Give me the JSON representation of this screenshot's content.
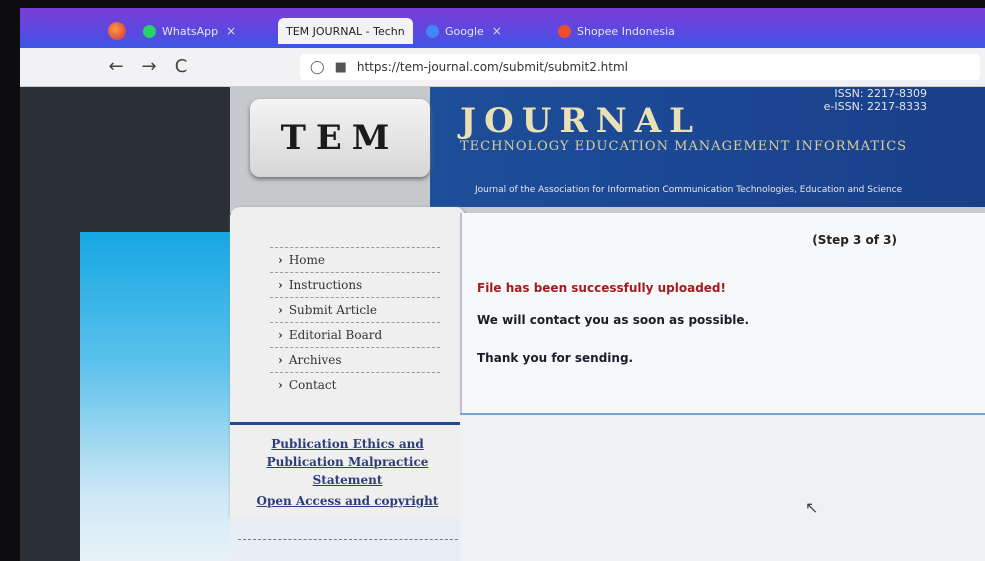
{
  "browser": {
    "tabs": [
      {
        "label": "WhatsApp",
        "icon": "whatsapp-icon",
        "color": "#25d366",
        "active": false
      },
      {
        "label": "TEM JOURNAL - Techn",
        "icon": "",
        "color": "",
        "active": true
      },
      {
        "label": "Google",
        "icon": "google-icon",
        "color": "#4285f4",
        "active": false
      },
      {
        "label": "Shopee Indonesia",
        "icon": "shopee-icon",
        "color": "#ee4d2d",
        "active": false
      }
    ],
    "close_glyph": "×",
    "back_glyph": "←",
    "forward_glyph": "→",
    "reload_glyph": "C",
    "url": "https://tem-journal.com/submit/submit2.html"
  },
  "header": {
    "logo_text": "TEM",
    "journal_title": "JOURNAL",
    "journal_subtitle": "TECHNOLOGY EDUCATION MANAGEMENT INFORMATICS",
    "issn": "ISSN: 2217-8309",
    "eissn": "e-ISSN: 2217-8333",
    "association": "Journal of the Association for Information Communication Technologies, Education and Science"
  },
  "sidebar": {
    "arrow": "›",
    "items": [
      {
        "label": "Home"
      },
      {
        "label": "Instructions"
      },
      {
        "label": "Submit Article"
      },
      {
        "label": "Editorial Board"
      },
      {
        "label": "Archives"
      },
      {
        "label": "Contact"
      }
    ],
    "ethics_line1": "Publication Ethics and",
    "ethics_line2": "Publication Malpractice Statement",
    "open_access": "Open Access and copyright"
  },
  "content": {
    "step": "(Step 3 of 3)",
    "success": "File has been successfully uploaded!",
    "contact": "We will contact you as soon as possible.",
    "thanks": "Thank you for sending."
  },
  "colors": {
    "header_blue": "#1d4e9a",
    "success_red": "#a11d1d",
    "link_blue": "#2d3c7a"
  }
}
